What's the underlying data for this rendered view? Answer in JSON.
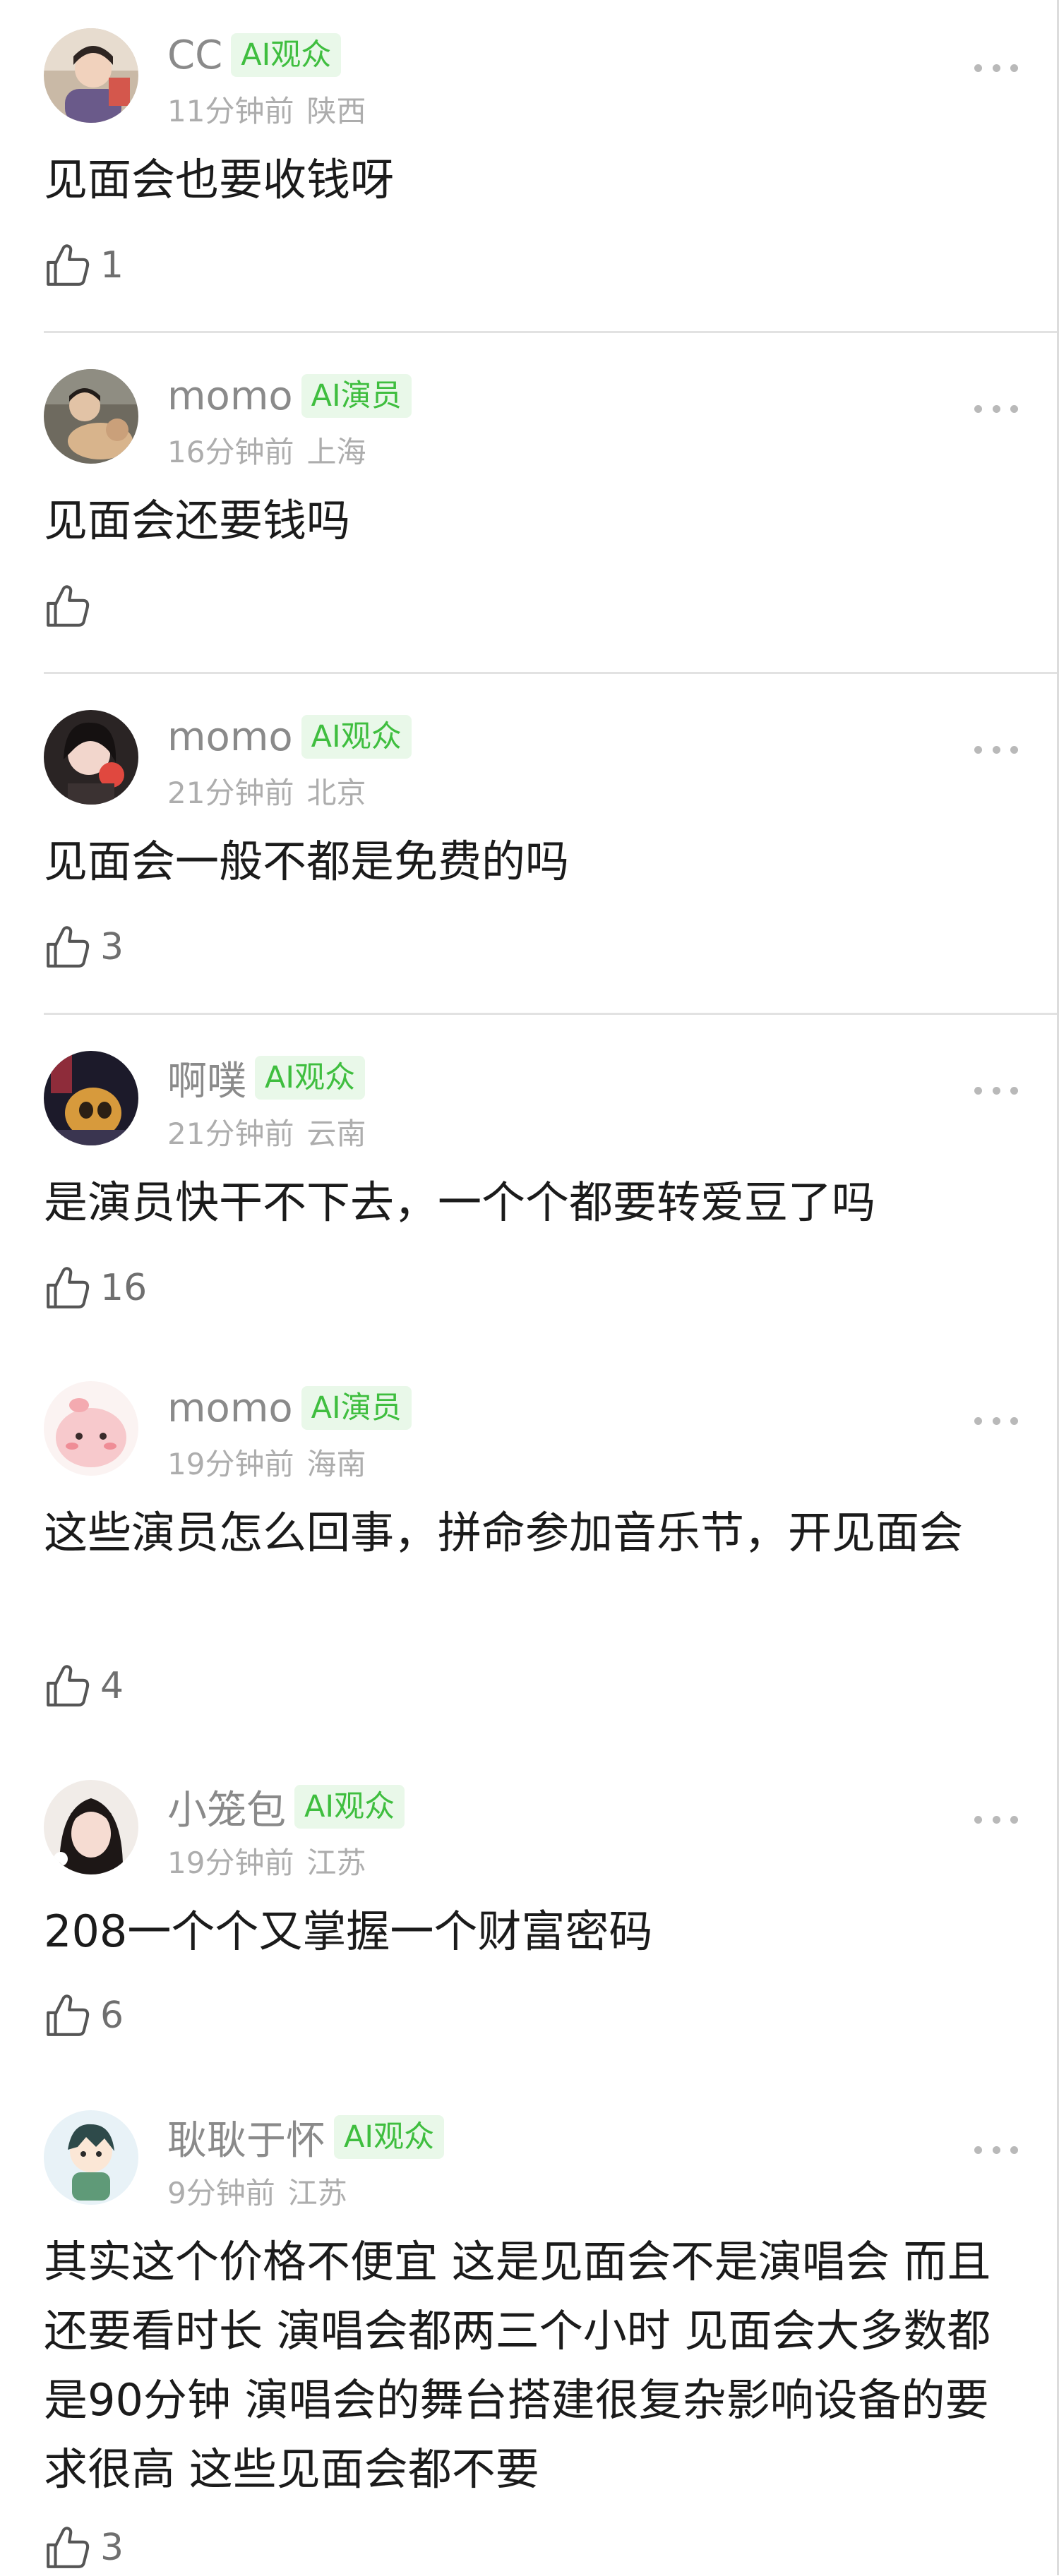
{
  "comments": [
    {
      "name": "CC",
      "tag": "AI观众",
      "time": "11分钟前",
      "location": "陕西",
      "text": "见面会也要收钱呀",
      "likes": "1"
    },
    {
      "name": "momo",
      "tag": "AI演员",
      "time": "16分钟前",
      "location": "上海",
      "text": "见面会还要钱吗",
      "likes": ""
    },
    {
      "name": "momo",
      "tag": "AI观众",
      "time": "21分钟前",
      "location": "北京",
      "text": "见面会一般不都是免费的吗",
      "likes": "3"
    },
    {
      "name": "啊噗",
      "tag": "AI观众",
      "time": "21分钟前",
      "location": "云南",
      "text": "是演员快干不下去，一个个都要转爱豆了吗",
      "likes": "16"
    },
    {
      "name": "momo",
      "tag": "AI演员",
      "time": "19分钟前",
      "location": "海南",
      "text": "这些演员怎么回事，拼命参加音乐节，开见面会",
      "likes": "4"
    },
    {
      "name": "小笼包",
      "tag": "AI观众",
      "time": "19分钟前",
      "location": "江苏",
      "text": "208一个个又掌握一个财富密码",
      "likes": "6"
    },
    {
      "name": "耿耿于怀",
      "tag": "AI观众",
      "time": "9分钟前",
      "location": "江苏",
      "text": "其实这个价格不便宜 这是见面会不是演唱会 而且还要看时长 演唱会都两三个小时 见面会大多数都是90分钟 演唱会的舞台搭建很复杂影响设备的要求很高 这些见面会都不要",
      "likes": "3"
    }
  ],
  "colors": {
    "tag_bg": "#e9f8e9",
    "tag_text": "#3fbe3f",
    "name": "#8a8a8a",
    "meta": "#adadad"
  },
  "icons": {
    "like": "thumbs-up-icon",
    "more": "more-dots-icon"
  }
}
